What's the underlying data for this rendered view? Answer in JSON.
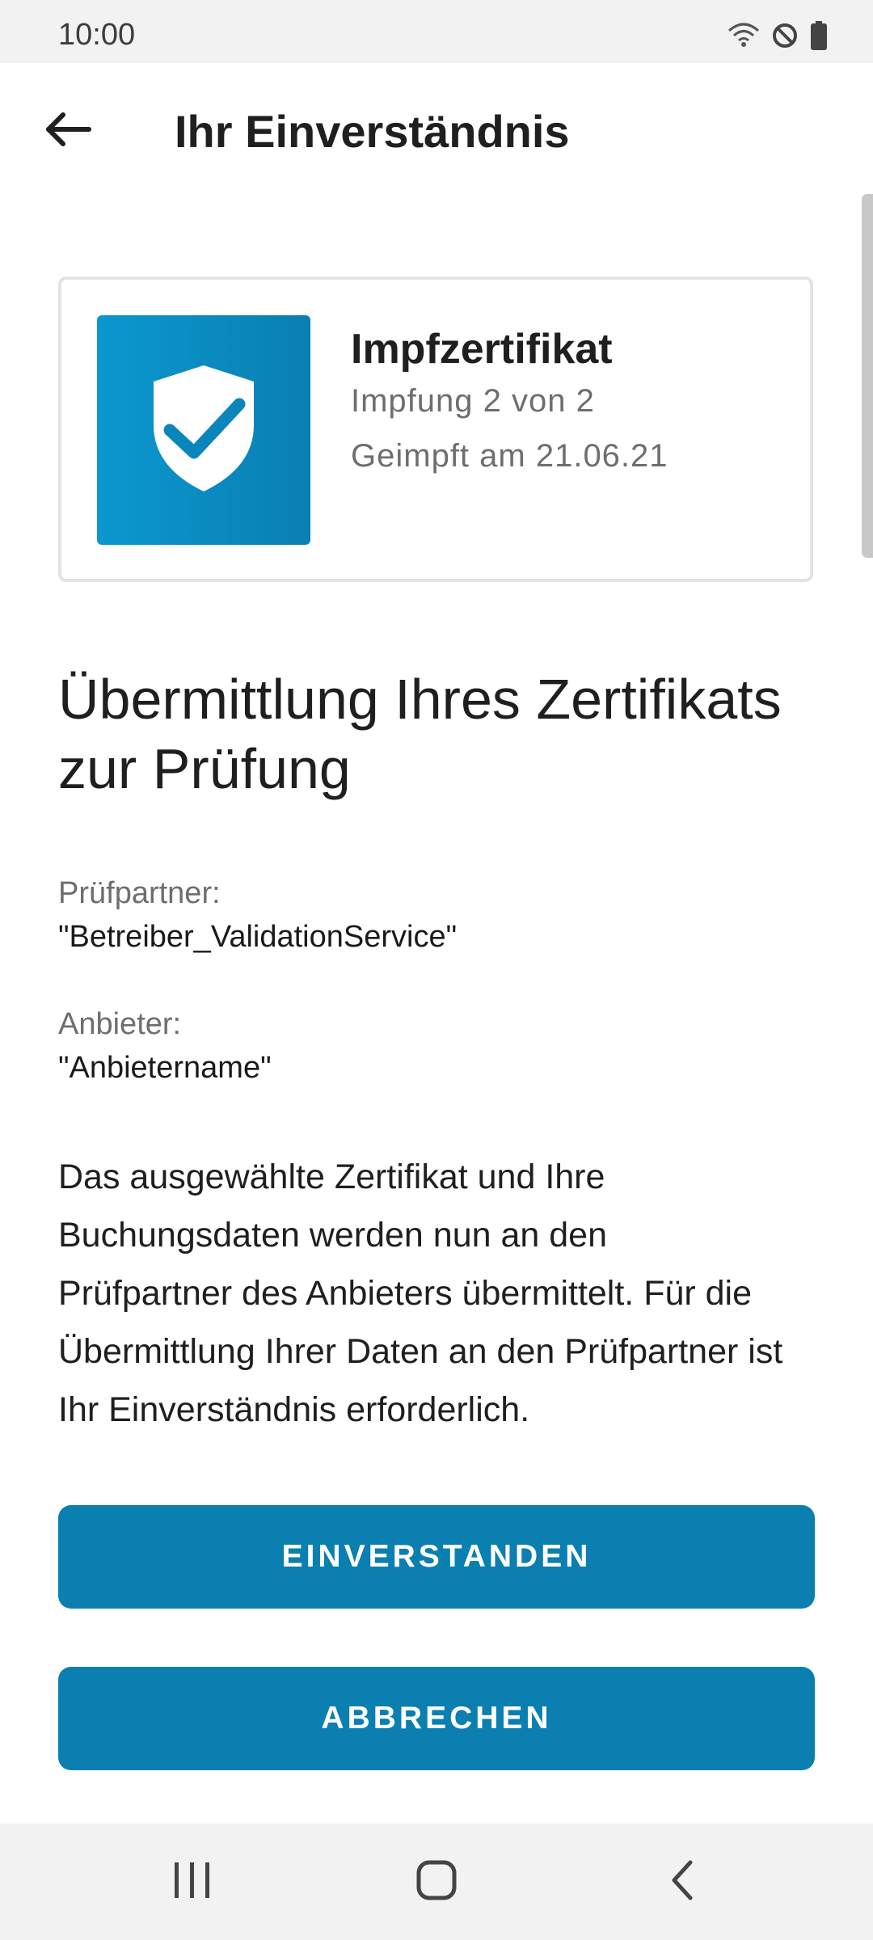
{
  "status_bar": {
    "time": "10:00"
  },
  "app_bar": {
    "title": "Ihr Einverständnis"
  },
  "certificate_card": {
    "title": "Impfzertifikat",
    "dose": "Impfung 2 von 2",
    "date": "Geimpft am 21.06.21",
    "icon": "shield-check-icon"
  },
  "heading": "Übermittlung Ihres Zertifikats zur Prüfung",
  "partner": {
    "label": "Prüfpartner:",
    "value": "\"Betreiber_ValidationService\""
  },
  "provider": {
    "label": "Anbieter:",
    "value": "\"Anbietername\""
  },
  "body_text": "Das ausgewählte Zertifikat und Ihre Buchungsdaten werden nun an den Prüfpartner des Anbieters übermittelt. Für die Übermittlung Ihrer Daten an den Prüfpartner ist Ihr Einverständnis erforderlich.",
  "buttons": {
    "agree": "EINVERSTANDEN",
    "cancel": "ABBRECHEN"
  },
  "colors": {
    "accent": "#0a7fb0",
    "icon_bg": "#0a98cf"
  }
}
